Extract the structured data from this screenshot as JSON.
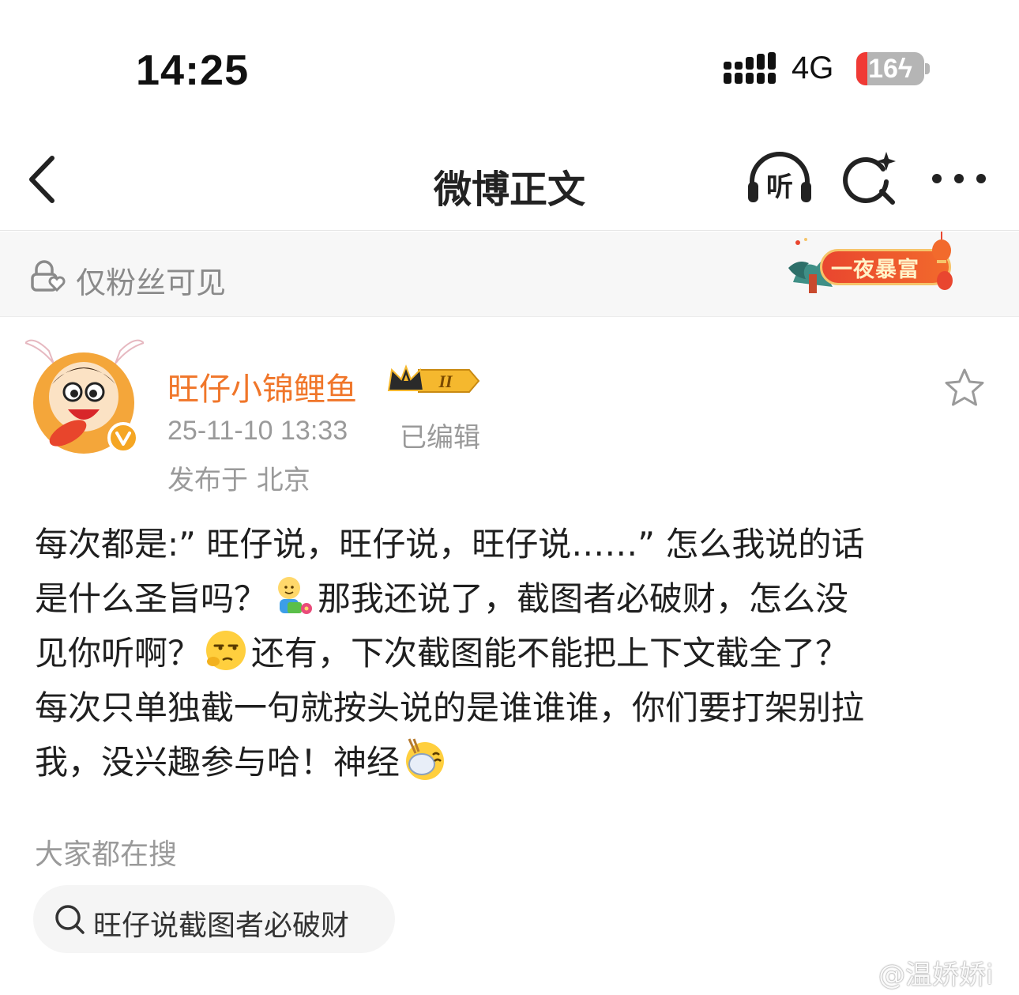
{
  "status_bar": {
    "time": "14:25",
    "network": "4G",
    "battery_level": "16"
  },
  "nav": {
    "title": "微博正文",
    "listen_label": "听"
  },
  "visibility": {
    "label": "仅粉丝可见",
    "promo_text": "一夜暴富"
  },
  "author": {
    "name": "旺仔小锦鲤鱼",
    "vip_level": "II",
    "timestamp": "25-11-10 13:33",
    "edited_label": "已编辑",
    "location": "发布于 北京"
  },
  "post": {
    "lines": [
      [
        "每次都是:” 旺仔说，旺仔说，旺仔说……” 怎么我说的话"
      ],
      [
        "是什么圣旨吗？",
        "那我还说了，截图者必破财，怎么没"
      ],
      [
        "见你听啊？",
        "还有，下次截图能不能把上下文截全了？"
      ],
      [
        "每次只单独截一句就按头说的是谁谁谁，你们要打架别拉"
      ],
      [
        "我，没兴趣参与哈！神经"
      ]
    ]
  },
  "everyone_searching": {
    "title": "大家都在搜",
    "chip_text": "旺仔说截图者必破财"
  },
  "watermark": "@温娇娇i",
  "icons": {
    "back": "chevron-left-icon",
    "listen": "headphones-icon",
    "search": "search-sparkle-icon",
    "more": "more-dots-icon",
    "visibility": "lock-heart-icon",
    "favorite": "star-icon"
  },
  "colors": {
    "author_name": "#f0762a",
    "muted_text": "#9a9a9a",
    "battery_low": "#f03a35"
  }
}
